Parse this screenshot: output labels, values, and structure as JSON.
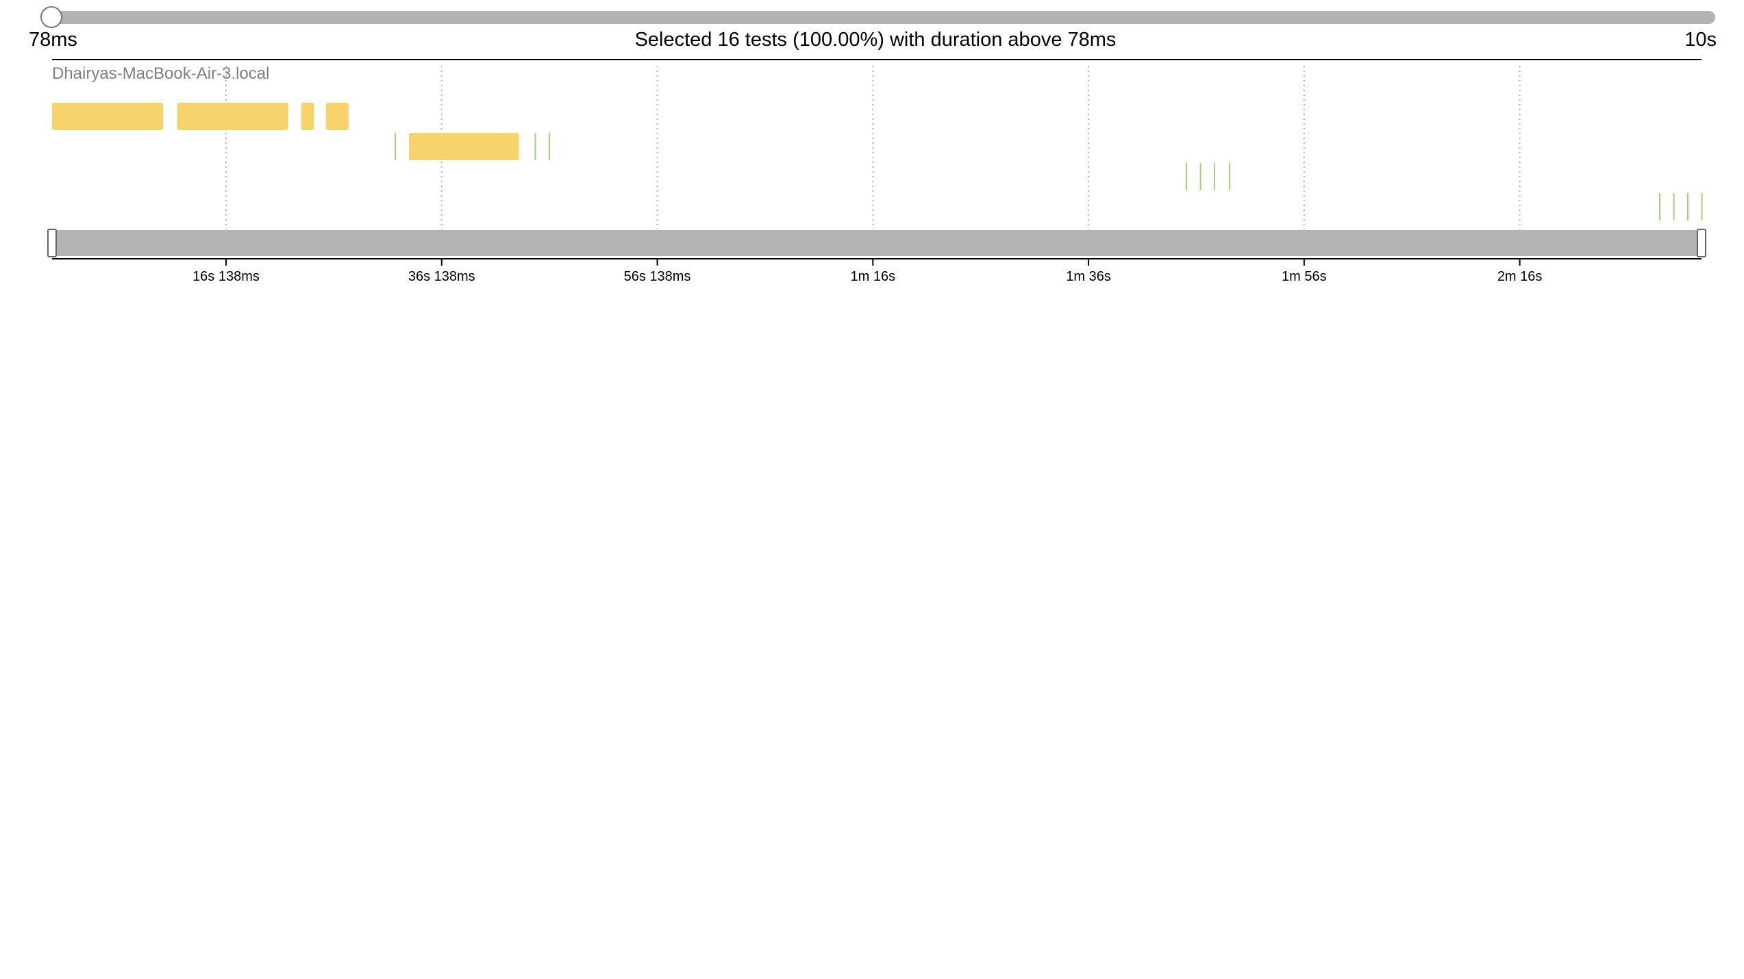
{
  "duration_filter": {
    "min_label": "78ms",
    "max_label": "10s",
    "selected_fraction": 0,
    "summary": "Selected 16 tests (100.00%) with duration above 78ms"
  },
  "chart_data": {
    "type": "timeline",
    "host": "Dhairyas-MacBook-Air-3.local",
    "x_unit": "seconds",
    "xlim": [
      0,
      153
    ],
    "tick_values": [
      16.138,
      36.138,
      56.138,
      76.138,
      96.138,
      116.138,
      136.138
    ],
    "tick_labels": [
      "16s 138ms",
      "36s 138ms",
      "56s 138ms",
      "1m 16s",
      "1m 36s",
      "1m 56s",
      "2m 16s"
    ],
    "grid": true,
    "brush": [
      0,
      153
    ],
    "colors": {
      "long_test": "#f7d46b",
      "short_test": "#9fd47a",
      "brush": "#b3b3b3"
    },
    "lanes": [
      [
        {
          "start": 0.0,
          "end": 10.3,
          "kind": "long"
        },
        {
          "start": 11.6,
          "end": 21.9,
          "kind": "long"
        },
        {
          "start": 23.1,
          "end": 24.3,
          "kind": "long"
        },
        {
          "start": 25.4,
          "end": 27.5,
          "kind": "long"
        }
      ],
      [
        {
          "start": 31.7,
          "end": 31.8,
          "kind": "short"
        },
        {
          "start": 33.1,
          "end": 43.3,
          "kind": "long"
        },
        {
          "start": 44.7,
          "end": 44.8,
          "kind": "short"
        },
        {
          "start": 46.0,
          "end": 46.1,
          "kind": "short"
        }
      ],
      [
        {
          "start": 105.1,
          "end": 105.2,
          "kind": "short"
        },
        {
          "start": 106.4,
          "end": 106.5,
          "kind": "short"
        },
        {
          "start": 107.7,
          "end": 107.8,
          "kind": "short"
        },
        {
          "start": 109.1,
          "end": 109.2,
          "kind": "short"
        }
      ],
      [
        {
          "start": 149.0,
          "end": 149.1,
          "kind": "short"
        },
        {
          "start": 150.3,
          "end": 150.4,
          "kind": "short"
        },
        {
          "start": 151.6,
          "end": 151.7,
          "kind": "short"
        },
        {
          "start": 152.9,
          "end": 153.0,
          "kind": "short"
        }
      ]
    ]
  }
}
